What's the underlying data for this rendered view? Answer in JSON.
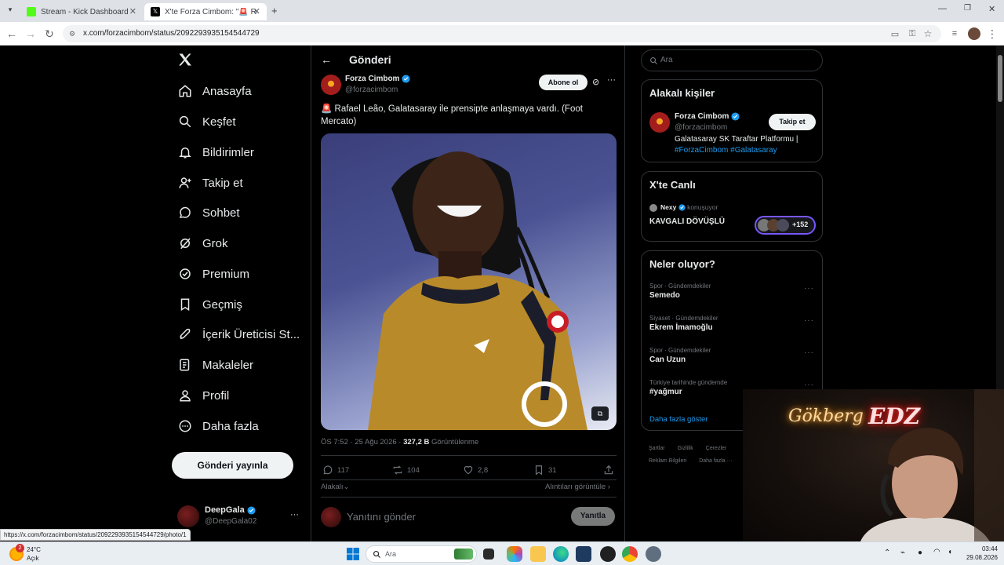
{
  "tabs": [
    {
      "title": "Stream - Kick Dashboard"
    },
    {
      "title": "X'te Forza Cimbom: \"🚨 Rafael"
    }
  ],
  "url": "x.com/forzacimbom/status/2092293935154544729",
  "nav": {
    "home": "Anasayfa",
    "explore": "Keşfet",
    "notifications": "Bildirimler",
    "follow": "Takip et",
    "chat": "Sohbet",
    "grok": "Grok",
    "premium": "Premium",
    "history": "Geçmiş",
    "creator": "İçerik Üreticisi St...",
    "articles": "Makaleler",
    "profile": "Profil",
    "more": "Daha fazla",
    "post_button": "Gönderi yayınla"
  },
  "account": {
    "name": "DeepGala",
    "handle": "@DeepGala02",
    "more": "···"
  },
  "header": {
    "title": "Gönderi"
  },
  "tweet": {
    "author_name": "Forza Cimbom",
    "author_handle": "@forzacimbom",
    "subscribe": "Abone ol",
    "text": "🚨 Rafael Leão, Galatasaray ile prensipte anlaşmaya vardı. (Foot Mercato)",
    "time": "ÖS 7:52 · 25 Ağu 2026 · ",
    "views_count": "327,2 B",
    "views_label": " Görüntülenme",
    "replies": "117",
    "retweets": "104",
    "likes": "2,8",
    "bookmarks": "31",
    "relevant": "Alakalı",
    "quotes": "Alıntıları görüntüle",
    "reply_placeholder": "Yanıtını gönder",
    "reply_button": "Yanıtla"
  },
  "search": {
    "placeholder": "Ara"
  },
  "relevant_people": {
    "title": "Alakalı kişiler",
    "name": "Forza Cimbom",
    "handle": "@forzacimbom",
    "follow": "Takip et",
    "bio": "Galatasaray SK Taraftar Platformu |",
    "tags": "#ForzaCimbom #Galatasaray"
  },
  "live": {
    "title": "X'te Canlı",
    "host": "Nexy",
    "host_status": "konuşuyor",
    "space_title": "KAVGALI DÖVÜŞLÜ",
    "listeners": "+152"
  },
  "trends": {
    "title": "Neler oluyor?",
    "items": [
      {
        "category": "Spor · Gündemdekiler",
        "name": "Semedo"
      },
      {
        "category": "Siyaset · Gündemdekiler",
        "name": "Ekrem İmamoğlu"
      },
      {
        "category": "Spor · Gündemdekiler",
        "name": "Can Uzun"
      },
      {
        "category": "Türkiye tarihinde gündemde",
        "name": "#yağmur"
      }
    ],
    "show_more": "Daha fazla göster"
  },
  "footer": {
    "terms": "Şartlar",
    "privacy": "Gizlilik",
    "cookies": "Çerezler",
    "ads": "Reklam Bilgileri",
    "more": "Daha fazla ···"
  },
  "status_url": "https://x.com/forzacimbom/status/2092293935154544729/photo/1",
  "webcam": {
    "neon_left": "Gökberg",
    "neon_right": "EDZ"
  },
  "taskbar": {
    "weather_temp": "24°C",
    "weather_desc": "Açık",
    "weather_badge": "2",
    "search": "Ara",
    "time": "03:44",
    "date": "29.08.2026"
  },
  "colors": {
    "accent": "#1d9bf0",
    "bg": "#000000",
    "border": "#2f3336",
    "muted": "#71767b"
  }
}
